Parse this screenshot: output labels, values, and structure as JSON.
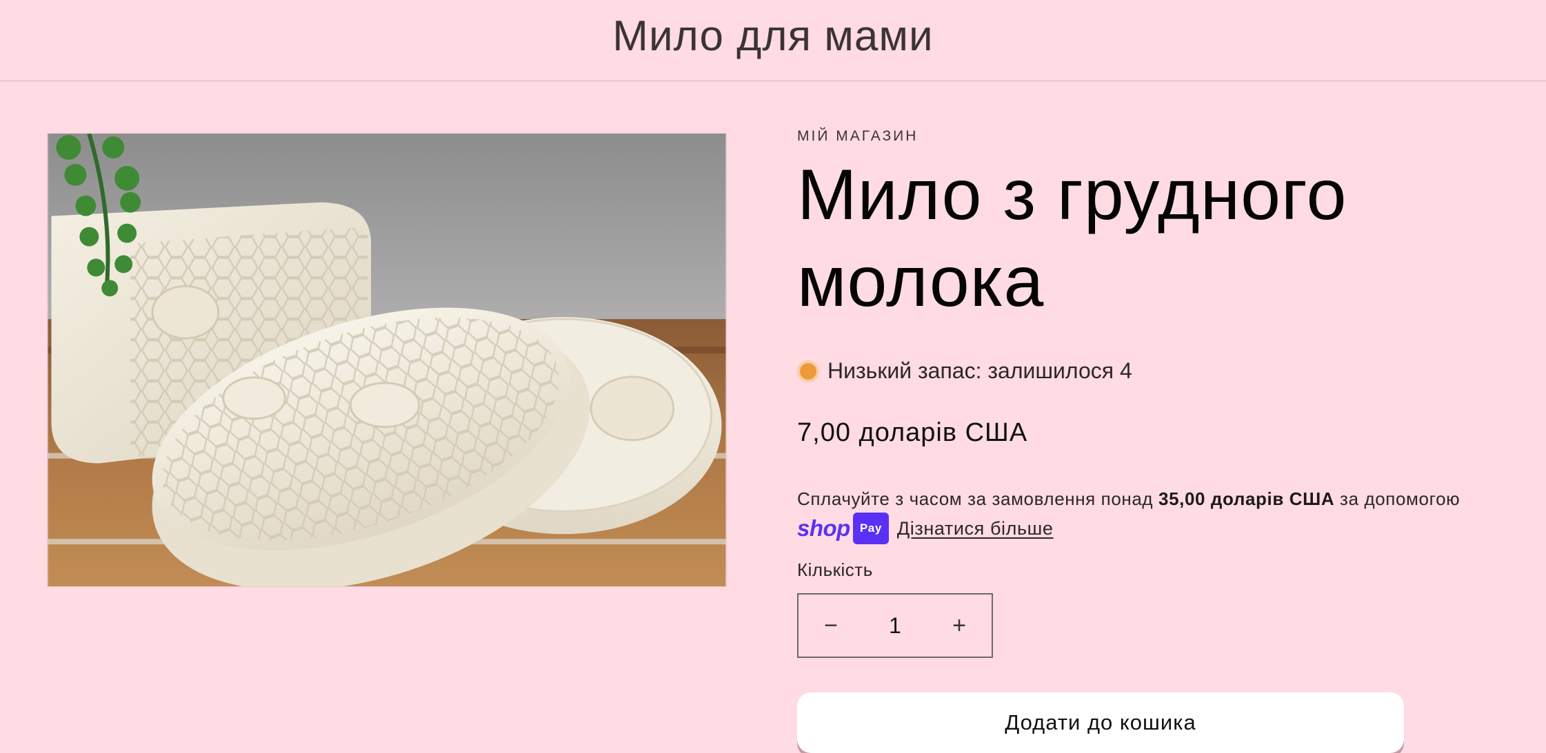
{
  "header": {
    "store_title": "Мило для мами"
  },
  "product": {
    "vendor": "МІЙ МАГАЗИН",
    "title": "Мило з грудного молока",
    "stock_text": "Низький запас: залишилося 4",
    "price": "7,00 доларів США",
    "installments": {
      "prefix": "Сплачуйте з часом за замовлення понад ",
      "threshold": "35,00 доларів США",
      "suffix": " за допомогою",
      "shop_word": "shop",
      "pay_badge": "Pay",
      "learn_more": "Дізнатися більше"
    },
    "quantity": {
      "label": "Кількість",
      "value": "1",
      "decrease_symbol": "−",
      "increase_symbol": "+"
    },
    "add_to_cart_label": "Додати до кошика"
  },
  "colors": {
    "background": "#ffdbe3",
    "stock_indicator": "#ef9a3a",
    "shop_pay_brand": "#5a31f4",
    "button_bg": "#ffffff"
  },
  "icons": {
    "stock_indicator": "low-stock-dot-icon",
    "shop_pay": "shop-pay-logo-icon"
  }
}
